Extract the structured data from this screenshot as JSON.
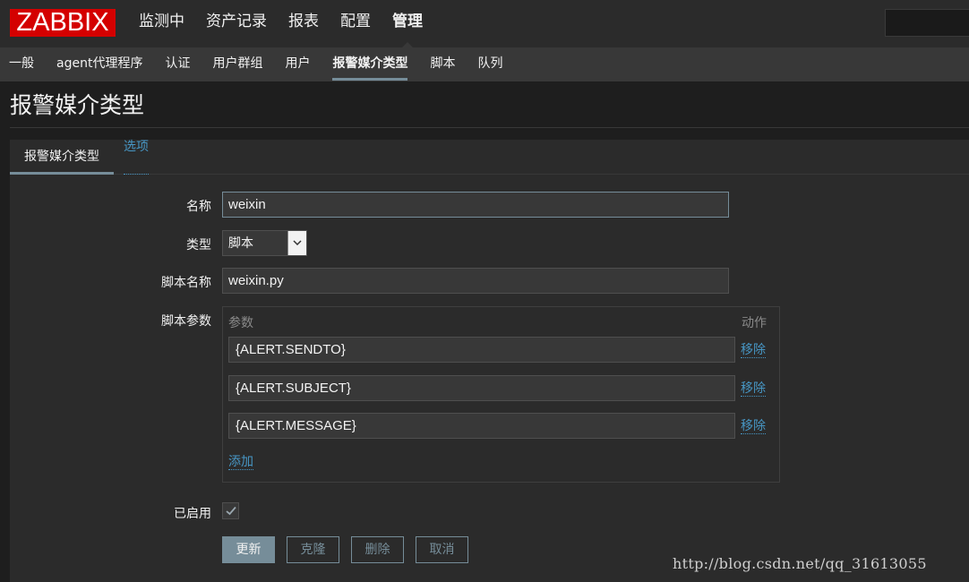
{
  "brand": {
    "logo_text": "ZABBIX",
    "color": "#d40000"
  },
  "topnav": {
    "items": [
      {
        "label": "监测中"
      },
      {
        "label": "资产记录"
      },
      {
        "label": "报表"
      },
      {
        "label": "配置"
      },
      {
        "label": "管理"
      }
    ],
    "active": "管理",
    "search_value": ""
  },
  "subnav": {
    "items": [
      {
        "label": "一般"
      },
      {
        "label": "agent代理程序"
      },
      {
        "label": "认证"
      },
      {
        "label": "用户群组"
      },
      {
        "label": "用户"
      },
      {
        "label": "报警媒介类型"
      },
      {
        "label": "脚本"
      },
      {
        "label": "队列"
      }
    ],
    "active": "报警媒介类型"
  },
  "page": {
    "title": "报警媒介类型"
  },
  "tabs": [
    {
      "label": "报警媒介类型",
      "active": true
    },
    {
      "label": "选项",
      "active": false
    }
  ],
  "form": {
    "name": {
      "label": "名称",
      "value": "weixin"
    },
    "type": {
      "label": "类型",
      "value": "脚本"
    },
    "script_name": {
      "label": "脚本名称",
      "value": "weixin.py"
    },
    "script_params": {
      "label": "脚本参数",
      "col_param": "参数",
      "col_action": "动作",
      "rows": [
        {
          "value": "{ALERT.SENDTO}",
          "action": "移除"
        },
        {
          "value": "{ALERT.SUBJECT}",
          "action": "移除"
        },
        {
          "value": "{ALERT.MESSAGE}",
          "action": "移除"
        }
      ],
      "add_label": "添加"
    },
    "enabled": {
      "label": "已启用",
      "checked": true
    }
  },
  "buttons": {
    "update": "更新",
    "clone": "克隆",
    "delete": "删除",
    "cancel": "取消"
  },
  "watermark": "http://blog.csdn.net/qq_31613055",
  "colors": {
    "accent": "#768d99",
    "link": "#4796c4",
    "background": "#2b2b2b"
  }
}
